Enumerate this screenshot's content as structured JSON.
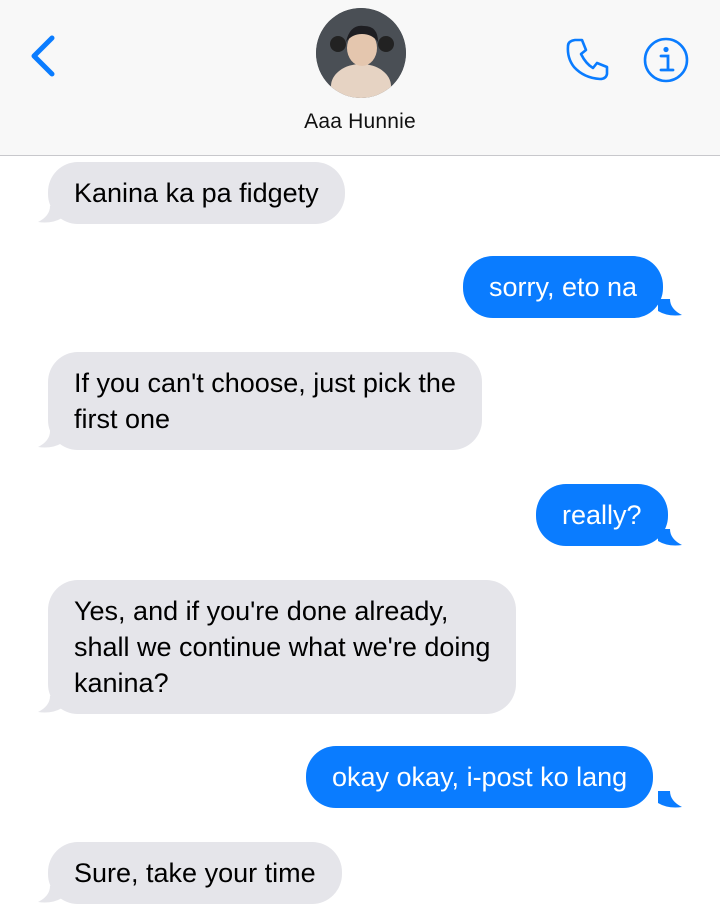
{
  "contact": {
    "name": "Aaa Hunnie"
  },
  "colors": {
    "accent": "#0a7cff",
    "incoming_bubble": "#e5e5ea",
    "header_bg": "#f8f8f8"
  },
  "icons": {
    "back": "chevron-left-icon",
    "call": "phone-icon",
    "info": "info-icon"
  },
  "messages": [
    {
      "direction": "incoming",
      "text": "Kanina ka pa fidgety"
    },
    {
      "direction": "outgoing",
      "text": "sorry, eto na"
    },
    {
      "direction": "incoming",
      "text": "If you can't choose, just pick the\nfirst one"
    },
    {
      "direction": "outgoing",
      "text": "really?"
    },
    {
      "direction": "incoming",
      "text": "Yes, and if you're done already,\nshall we continue what we're doing\nkanina?"
    },
    {
      "direction": "outgoing",
      "text": "okay okay, i-post ko lang"
    },
    {
      "direction": "incoming",
      "text": "Sure, take your time"
    }
  ]
}
